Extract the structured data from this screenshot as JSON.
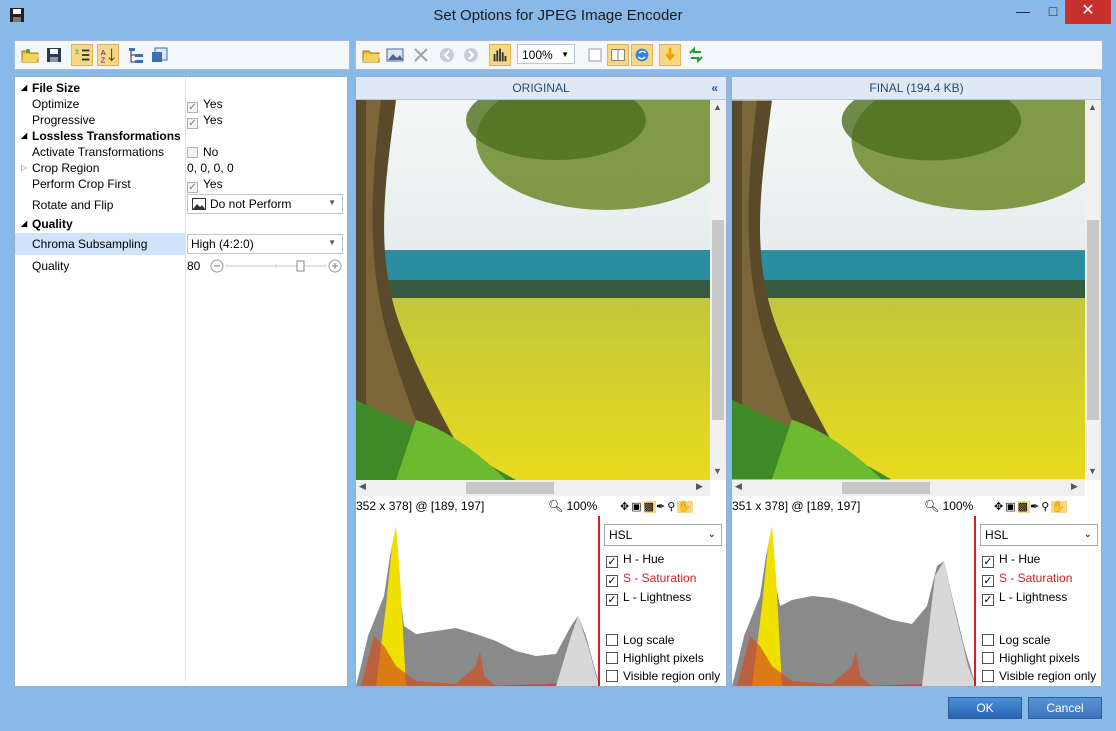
{
  "window": {
    "title": "Set Options for JPEG Image Encoder"
  },
  "colors": {
    "accent": "#2765b4",
    "close": "#c7302b",
    "saturation_red": "#d02020"
  },
  "property_grid": {
    "categories": [
      {
        "label": "File Size",
        "rows": [
          {
            "name": "Optimize",
            "value": "Yes",
            "checkbox": true
          },
          {
            "name": "Progressive",
            "value": "Yes",
            "checkbox": true
          }
        ]
      },
      {
        "label": "Lossless Transformations",
        "rows": [
          {
            "name": "Activate Transformations",
            "value": "No",
            "checkbox": false
          },
          {
            "name": "Crop Region",
            "value": "0, 0, 0, 0"
          },
          {
            "name": "Perform Crop First",
            "value": "Yes",
            "checkbox": true
          },
          {
            "name": "Rotate and Flip",
            "value": "Do not Perform"
          }
        ]
      },
      {
        "label": "Quality",
        "rows": [
          {
            "name": "Chroma Subsampling",
            "value": "High (4:2:0)"
          },
          {
            "name": "Quality",
            "value": "80"
          }
        ]
      }
    ]
  },
  "viewer_toolbar": {
    "zoom": "100%"
  },
  "panels": {
    "original": {
      "header": "ORIGINAL",
      "status_left": "352 x 378] @ [189, 197]",
      "zoom": "100%"
    },
    "final": {
      "header": "FINAL (194.4 KB)",
      "status_left": "351 x 378] @ [189, 197]",
      "zoom": "100%"
    }
  },
  "histogram": {
    "mode": "HSL",
    "channels": [
      {
        "label": "H - Hue",
        "checked": true
      },
      {
        "label": "S - Saturation",
        "checked": true
      },
      {
        "label": "L - Lightness",
        "checked": true
      }
    ],
    "options": [
      {
        "label": "Log scale",
        "checked": false
      },
      {
        "label": "Highlight pixels",
        "checked": false
      },
      {
        "label": "Visible region only",
        "checked": false
      }
    ]
  },
  "buttons": {
    "ok": "OK",
    "cancel": "Cancel"
  }
}
